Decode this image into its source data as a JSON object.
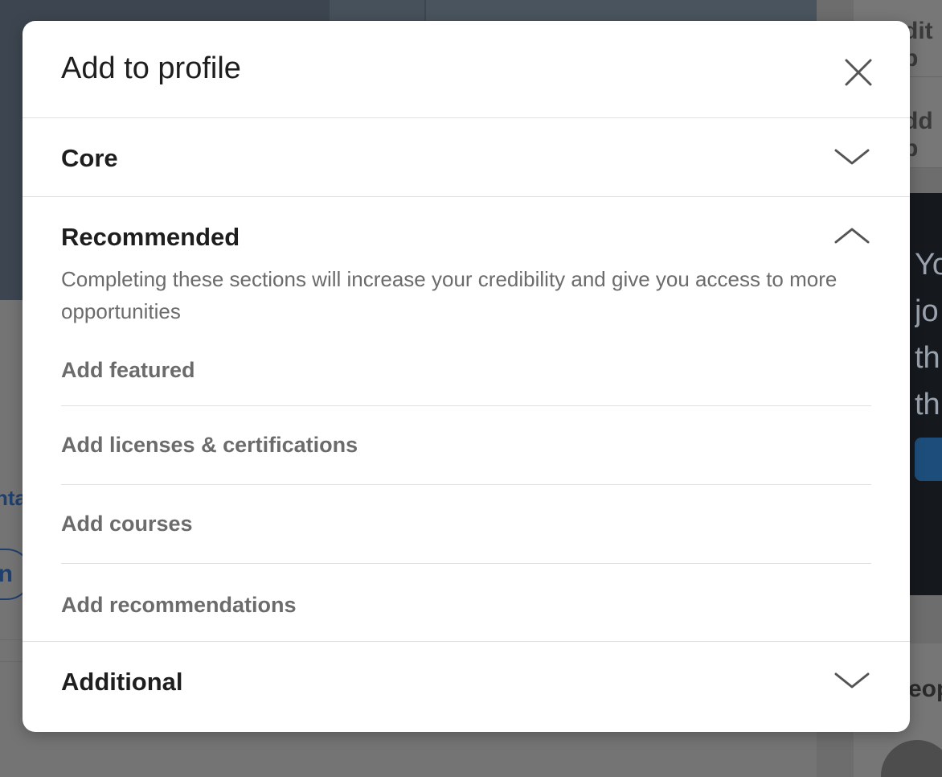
{
  "background": {
    "left_link_fragment": "nta",
    "left_button_fragment": "n",
    "side_text_1": "dit p",
    "side_text_2": "dd p",
    "side_ad_text": [
      "Yo",
      "jo",
      "th",
      "th"
    ],
    "side_text_3": "eop"
  },
  "modal": {
    "title": "Add to profile",
    "close_icon": "close-icon",
    "sections": {
      "core": {
        "title": "Core",
        "expanded": false
      },
      "recommended": {
        "title": "Recommended",
        "expanded": true,
        "description": "Completing these sections will increase your credibility and give you access to more opportunities",
        "items": [
          {
            "label": "Add featured"
          },
          {
            "label": "Add licenses & certifications"
          },
          {
            "label": "Add courses"
          },
          {
            "label": "Add recommendations"
          }
        ]
      },
      "additional": {
        "title": "Additional",
        "expanded": false
      }
    }
  },
  "colors": {
    "modal_bg": "#ffffff",
    "title_text": "#1e1e1e",
    "muted_text": "#6b6b6b",
    "divider": "#e0e0e0",
    "overlay": "#6f6f6f"
  }
}
